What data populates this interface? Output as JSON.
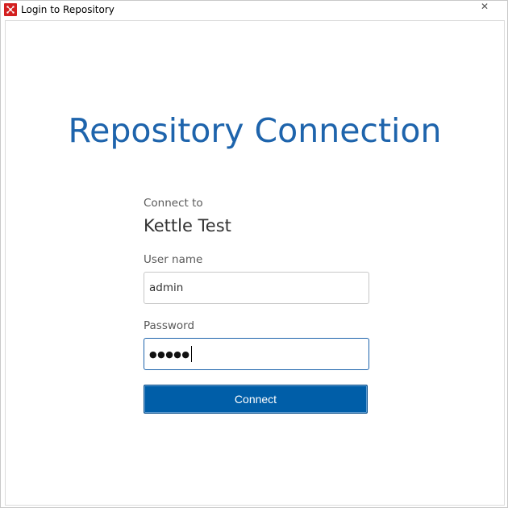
{
  "window": {
    "title": "Login to Repository",
    "close_glyph": "✕"
  },
  "main": {
    "heading": "Repository Connection",
    "connect_to_label": "Connect to",
    "repository_name": "Kettle Test",
    "username_label": "User name",
    "username_value": "admin",
    "password_label": "Password",
    "password_masked": "●●●●●",
    "connect_button_label": "Connect"
  },
  "icons": {
    "app_icon": "kettle-app-icon",
    "close_icon": "close-icon"
  },
  "colors": {
    "heading": "#1e64ac",
    "button": "#005ea8",
    "app_icon": "#d32020"
  }
}
